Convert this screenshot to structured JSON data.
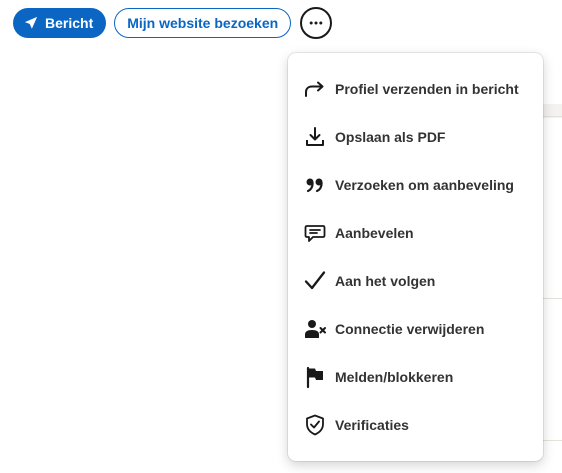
{
  "actions": {
    "message_label": "Bericht",
    "website_label": "Mijn website bezoeken",
    "more_icon": "ellipsis-icon"
  },
  "menu": {
    "items": [
      {
        "label": "Profiel verzenden in bericht",
        "icon": "share-arrow-icon"
      },
      {
        "label": "Opslaan als PDF",
        "icon": "download-icon"
      },
      {
        "label": "Verzoeken om aanbeveling",
        "icon": "quote-icon"
      },
      {
        "label": "Aanbevelen",
        "icon": "speech-bubble-icon"
      },
      {
        "label": "Aan het volgen",
        "icon": "checkmark-icon"
      },
      {
        "label": "Connectie verwijderen",
        "icon": "remove-person-icon"
      },
      {
        "label": "Melden/blokkeren",
        "icon": "flag-icon"
      },
      {
        "label": "Verificaties",
        "icon": "shield-check-icon"
      }
    ]
  },
  "colors": {
    "primary": "#0a66c2",
    "text": "#333333",
    "icon": "#191919"
  }
}
